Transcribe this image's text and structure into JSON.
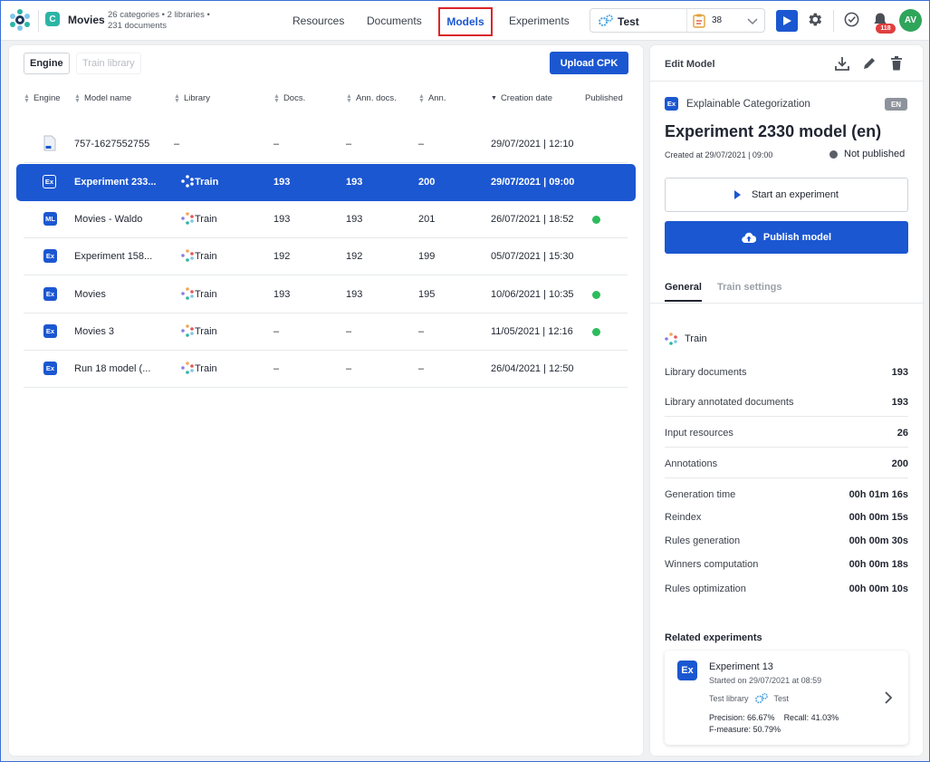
{
  "header": {
    "project_initial": "C",
    "project_name": "Movies",
    "project_meta_line1": "26 categories • 2 libraries •",
    "project_meta_line2": "231 documents",
    "nav": [
      "Resources",
      "Documents",
      "Models",
      "Experiments"
    ],
    "active_nav": "Models",
    "env_name": "Test",
    "env_count": "38",
    "notification_count": "118",
    "avatar_initials": "AV"
  },
  "left": {
    "tab_engine": "Engine",
    "tab_train_library": "Train library",
    "upload_label": "Upload CPK",
    "columns": [
      "Engine",
      "Model name",
      "Library",
      "Docs.",
      "Ann. docs.",
      "Ann.",
      "Creation date",
      "Published"
    ],
    "rows": [
      {
        "engine": "doc",
        "name": "757-1627552755",
        "library": "–",
        "docs": "–",
        "ann_docs": "–",
        "ann": "–",
        "date": "29/07/2021 | 12:10",
        "published": false,
        "selected": false
      },
      {
        "engine": "Ex",
        "name": "Experiment 233...",
        "library": "Train",
        "docs": "193",
        "ann_docs": "193",
        "ann": "200",
        "date": "29/07/2021 | 09:00",
        "published": false,
        "selected": true
      },
      {
        "engine": "ML",
        "name": "Movies - Waldo",
        "library": "Train",
        "docs": "193",
        "ann_docs": "193",
        "ann": "201",
        "date": "26/07/2021 | 18:52",
        "published": true,
        "selected": false
      },
      {
        "engine": "Ex",
        "name": "Experiment 158...",
        "library": "Train",
        "docs": "192",
        "ann_docs": "192",
        "ann": "199",
        "date": "05/07/2021 | 15:30",
        "published": false,
        "selected": false
      },
      {
        "engine": "Ex",
        "name": "Movies",
        "library": "Train",
        "docs": "193",
        "ann_docs": "193",
        "ann": "195",
        "date": "10/06/2021 | 10:35",
        "published": true,
        "selected": false
      },
      {
        "engine": "Ex",
        "name": "Movies 3",
        "library": "Train",
        "docs": "–",
        "ann_docs": "–",
        "ann": "–",
        "date": "11/05/2021 | 12:16",
        "published": true,
        "selected": false
      },
      {
        "engine": "Ex",
        "name": "Run 18 model (...",
        "library": "Train",
        "docs": "–",
        "ann_docs": "–",
        "ann": "–",
        "date": "26/04/2021 | 12:50",
        "published": false,
        "selected": false
      }
    ]
  },
  "right": {
    "title": "Edit Model",
    "engine_badge": "Ex",
    "engine_name": "Explainable Categorization",
    "lang": "EN",
    "model_title": "Experiment 2330 model (en)",
    "created": "Created at 29/07/2021 | 09:00",
    "status": "Not published",
    "start_label": "Start an experiment",
    "publish_label": "Publish model",
    "tab_general": "General",
    "tab_train_settings": "Train settings",
    "library": "Train",
    "stats": [
      {
        "label": "Library documents",
        "value": "193"
      },
      {
        "label": "Library annotated documents",
        "value": "193"
      },
      {
        "label": "Input resources",
        "value": "26"
      },
      {
        "label": "Annotations",
        "value": "200"
      }
    ],
    "timings": [
      {
        "label": "Generation time",
        "value": "00h 01m 16s"
      },
      {
        "label": "Reindex",
        "value": "00h 00m 15s"
      },
      {
        "label": "Rules generation",
        "value": "00h 00m 30s"
      },
      {
        "label": "Winners computation",
        "value": "00h 00m 18s"
      },
      {
        "label": "Rules optimization",
        "value": "00h 00m 10s"
      }
    ],
    "related_title": "Related experiments",
    "related": {
      "badge": "Ex",
      "name": "Experiment 13",
      "started": "Started on 29/07/2021 at 08:59",
      "library": "Test library",
      "env": "Test",
      "precision": "Precision: 66.67%",
      "recall": "Recall: 41.03%",
      "fmeasure": "F-measure: 50.79%"
    }
  }
}
